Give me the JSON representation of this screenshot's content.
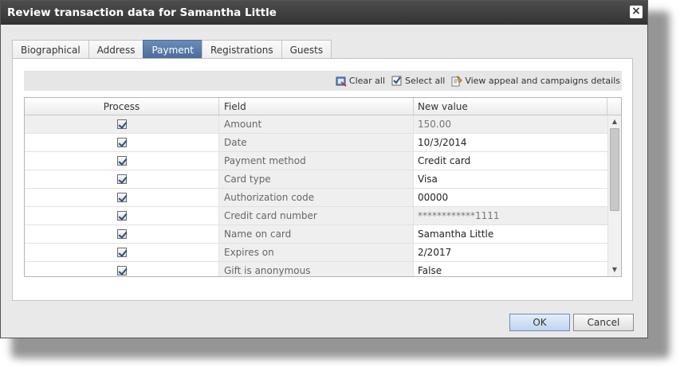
{
  "dialog": {
    "title": "Review transaction data for Samantha Little",
    "close_label": "×"
  },
  "tabs": [
    {
      "label": "Biographical",
      "active": false
    },
    {
      "label": "Address",
      "active": false
    },
    {
      "label": "Payment",
      "active": true
    },
    {
      "label": "Registrations",
      "active": false
    },
    {
      "label": "Guests",
      "active": false
    }
  ],
  "toolbar": {
    "clear_all": "Clear all",
    "select_all": "Select all",
    "view_appeal": "View appeal and campaigns details"
  },
  "grid": {
    "columns": [
      "Process",
      "Field",
      "New value"
    ],
    "rows": [
      {
        "checked": true,
        "field": "Amount",
        "value": "150.00"
      },
      {
        "checked": true,
        "field": "Date",
        "value": "10/3/2014"
      },
      {
        "checked": true,
        "field": "Payment method",
        "value": "Credit card"
      },
      {
        "checked": true,
        "field": "Card type",
        "value": "Visa"
      },
      {
        "checked": true,
        "field": "Authorization code",
        "value": "00000"
      },
      {
        "checked": true,
        "field": "Credit card number",
        "value": "************1111"
      },
      {
        "checked": true,
        "field": "Name on card",
        "value": "Samantha Little"
      },
      {
        "checked": true,
        "field": "Expires on",
        "value": "2/2017"
      },
      {
        "checked": true,
        "field": "Gift is anonymous",
        "value": "False"
      }
    ]
  },
  "buttons": {
    "ok": "OK",
    "cancel": "Cancel"
  },
  "colors": {
    "active_tab": "#5a7aaa",
    "titlebar": "#3d3d3d"
  }
}
